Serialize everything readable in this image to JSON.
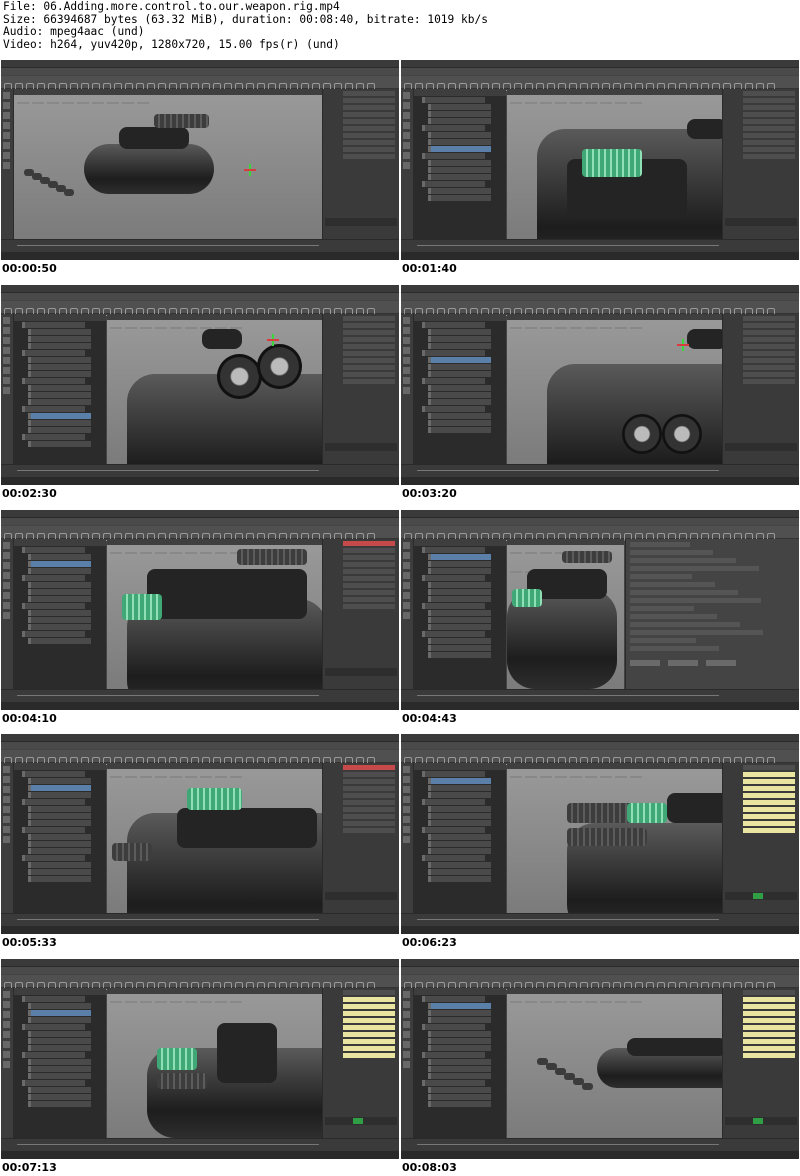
{
  "header": {
    "file_line": "File: 06.Adding.more.control.to.our.weapon.rig.mp4",
    "size_line": "Size: 66394687 bytes (63.32 MiB), duration: 00:08:40, bitrate: 1019 kb/s",
    "audio_line": "Audio: mpeg4aac (und)",
    "video_line": "Video: h264, yuv420p, 1280x720, 15.00 fps(r) (und)"
  },
  "thumbnails": [
    {
      "timestamp": "00:00:50",
      "scene": "side view of weapon arm rig, full model"
    },
    {
      "timestamp": "00:01:40",
      "scene": "close-up of barrel with green cylinder selected"
    },
    {
      "timestamp": "00:02:30",
      "scene": "close-up of barrel with lens parts"
    },
    {
      "timestamp": "00:03:20",
      "scene": "top of arm with binocular lenses"
    },
    {
      "timestamp": "00:04:10",
      "scene": "gun body with green drum and outliner"
    },
    {
      "timestamp": "00:04:43",
      "scene": "Attribute editor dialog open"
    },
    {
      "timestamp": "00:05:33",
      "scene": "gun body with green drum, channel box"
    },
    {
      "timestamp": "00:06:23",
      "scene": "gun barrels close-up with yellow channel values"
    },
    {
      "timestamp": "00:07:13",
      "scene": "green drum on arm body, yellow channels"
    },
    {
      "timestamp": "00:08:03",
      "scene": "full arm side view with hand"
    }
  ],
  "colors": {
    "highlight_green": "#3fa876",
    "channel_yellow": "#e9e5a0",
    "selection_blue": "#5a7fa8",
    "ui_dark": "#444444"
  }
}
